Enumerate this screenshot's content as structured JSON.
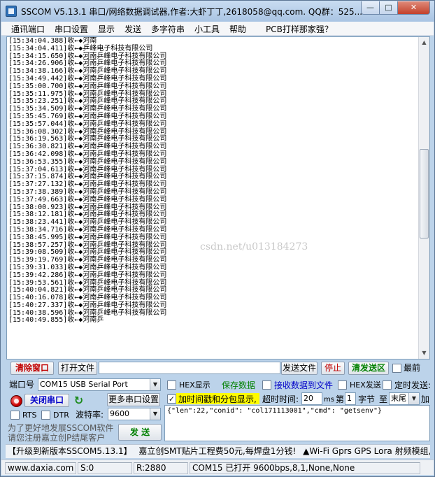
{
  "window": {
    "title": "SSCOM V5.13.1 串口/网络数据调试器,作者:大虾丁丁,2618058@qq.com. QQ群：525...",
    "minimize": "—",
    "maximize": "□",
    "close": "✕"
  },
  "menu": [
    "通讯端口",
    "串口设置",
    "显示",
    "发送",
    "多字符串",
    "小工具",
    "帮助",
    "PCB打样那家强？"
  ],
  "receive_lines": [
    "[15:34:04.388]收←◆河南",
    "[15:34:04.411]收←◆乒峰电子科技有限公司",
    "[15:34:15.650]收←◆河南乒峰电子科技有限公司",
    "[15:34:26.906]收←◆河南乒峰电子科技有限公司",
    "[15:34:38.166]收←◆河南乒峰电子科技有限公司",
    "[15:34:49.442]收←◆河南乒峰电子科技有限公司",
    "[15:35:00.700]收←◆河南乒峰电子科技有限公司",
    "[15:35:11.975]收←◆河南乒峰电子科技有限公司",
    "[15:35:23.251]收←◆河南乒峰电子科技有限公司",
    "[15:35:34.509]收←◆河南乒峰电子科技有限公司",
    "[15:35:45.769]收←◆河南乒峰电子科技有限公司",
    "[15:35:57.044]收←◆河南乒峰电子科技有限公司",
    "[15:36:08.302]收←◆河南乒峰电子科技有限公司",
    "[15:36:19.563]收←◆河南乒峰电子科技有限公司",
    "[15:36:30.821]收←◆河南乒峰电子科技有限公司",
    "[15:36:42.098]收←◆河南乒峰电子科技有限公司",
    "[15:36:53.355]收←◆河南乒峰电子科技有限公司",
    "[15:37:04.613]收←◆河南乒峰电子科技有限公司",
    "[15:37:15.874]收←◆河南乒峰电子科技有限公司",
    "[15:37:27.132]收←◆河南乒峰电子科技有限公司",
    "[15:37:38.389]收←◆河南乒峰电子科技有限公司",
    "[15:37:49.663]收←◆河南乒峰电子科技有限公司",
    "[15:38:00.923]收←◆河南乒峰电子科技有限公司",
    "[15:38:12.181]收←◆河南乒峰电子科技有限公司",
    "[15:38:23.441]收←◆河南乒峰电子科技有限公司",
    "[15:38:34.716]收←◆河南乒峰电子科技有限公司",
    "[15:38:45.995]收←◆河南乒峰电子科技有限公司",
    "[15:38:57.257]收←◆河南乒峰电子科技有限公司",
    "[15:39:08.509]收←◆河南乒峰电子科技有限公司",
    "[15:39:19.769]收←◆河南乒峰电子科技有限公司",
    "[15:39:31.033]收←◆河南乒峰电子科技有限公司",
    "[15:39:42.286]收←◆河南乒峰电子科技有限公司",
    "[15:39:53.561]收←◆河南乒峰电子科技有限公司",
    "[15:40:04.821]收←◆河南乒峰电子科技有限公司",
    "[15:40:16.078]收←◆河南乒峰电子科技有限公司",
    "[15:40:27.337]收←◆河南乒峰电子科技有限公司",
    "[15:40:38.596]收←◆河南乒峰电子科技有限公司",
    "[15:40:49.855]收←◆河南乒"
  ],
  "watermark": "csdn.net/u013184273",
  "toolbar": {
    "clear_window": "清除窗口",
    "open_file": "打开文件",
    "file_path": "",
    "send_file": "发送文件",
    "stop": "停止",
    "clear_send": "清发送区",
    "last_label": "最前"
  },
  "port": {
    "label": "端口号",
    "value": "COM15 USB Serial Port",
    "close_button": "关闭串口",
    "more_settings": "更多串口设置",
    "rts_label": "RTS",
    "dtr_label": "DTR",
    "baud_label": "波特率:",
    "baud_value": "9600"
  },
  "options": {
    "hex_display": "HEX显示",
    "save_data": "保存数据",
    "recv_to_file": "接收数据到文件",
    "hex_send": "HEX发送",
    "timed_send": "定时发送:",
    "timestamp_label": "加时间戳和分包显示,",
    "timeout_label": "超时时间:",
    "timeout_value": "20",
    "ms_label": "ms",
    "nth_label": "第",
    "byte_index": "1",
    "byte_label": "字节",
    "to_label": "至",
    "tail_value": "末尾",
    "add_label": "加"
  },
  "send_box": "{\"len\":22,\"conid\": \"col171113001\",\"cmd\": \"getsenv\"}",
  "promo": {
    "line1": "为了更好地发展SSCOM软件",
    "line2": "请您注册嘉立创P结尾客户",
    "send_button": "发 送"
  },
  "banner": {
    "upgrade": "【升级到新版本SSCOM5.13.1】",
    "ad1": "嘉立创SMT贴片工程费50元,每焊盘1分钱!",
    "ad2": "▲Wi-Fi Gprs GPS Lora 射频模组,"
  },
  "status": {
    "website": "www.daxia.com",
    "sent": "S:0",
    "received": "R:2880",
    "port_state": "COM15 已打开  9600bps,8,1,None,None"
  }
}
